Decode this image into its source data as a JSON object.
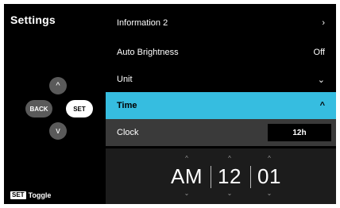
{
  "left": {
    "title": "Settings",
    "keys": {
      "up": "^",
      "down": "v",
      "back": "BACK",
      "set": "SET"
    },
    "toggle_badge": "SET",
    "toggle_label": "Toggle"
  },
  "menu": {
    "items": [
      {
        "label": "Information 2",
        "value": "›"
      },
      {
        "label": "Auto Brightness",
        "value": "Off"
      },
      {
        "label": "Unit",
        "value": "⌄"
      },
      {
        "label": "Time",
        "value": "^"
      },
      {
        "label": "Clock",
        "value": "12h"
      }
    ]
  },
  "time": {
    "ampm": "AM",
    "hour": "12",
    "minute": "01",
    "up": "^",
    "down": "⌄"
  },
  "colors": {
    "highlight": "#36bde0",
    "background": "#000000",
    "row_alt": "#3a3a3a"
  }
}
